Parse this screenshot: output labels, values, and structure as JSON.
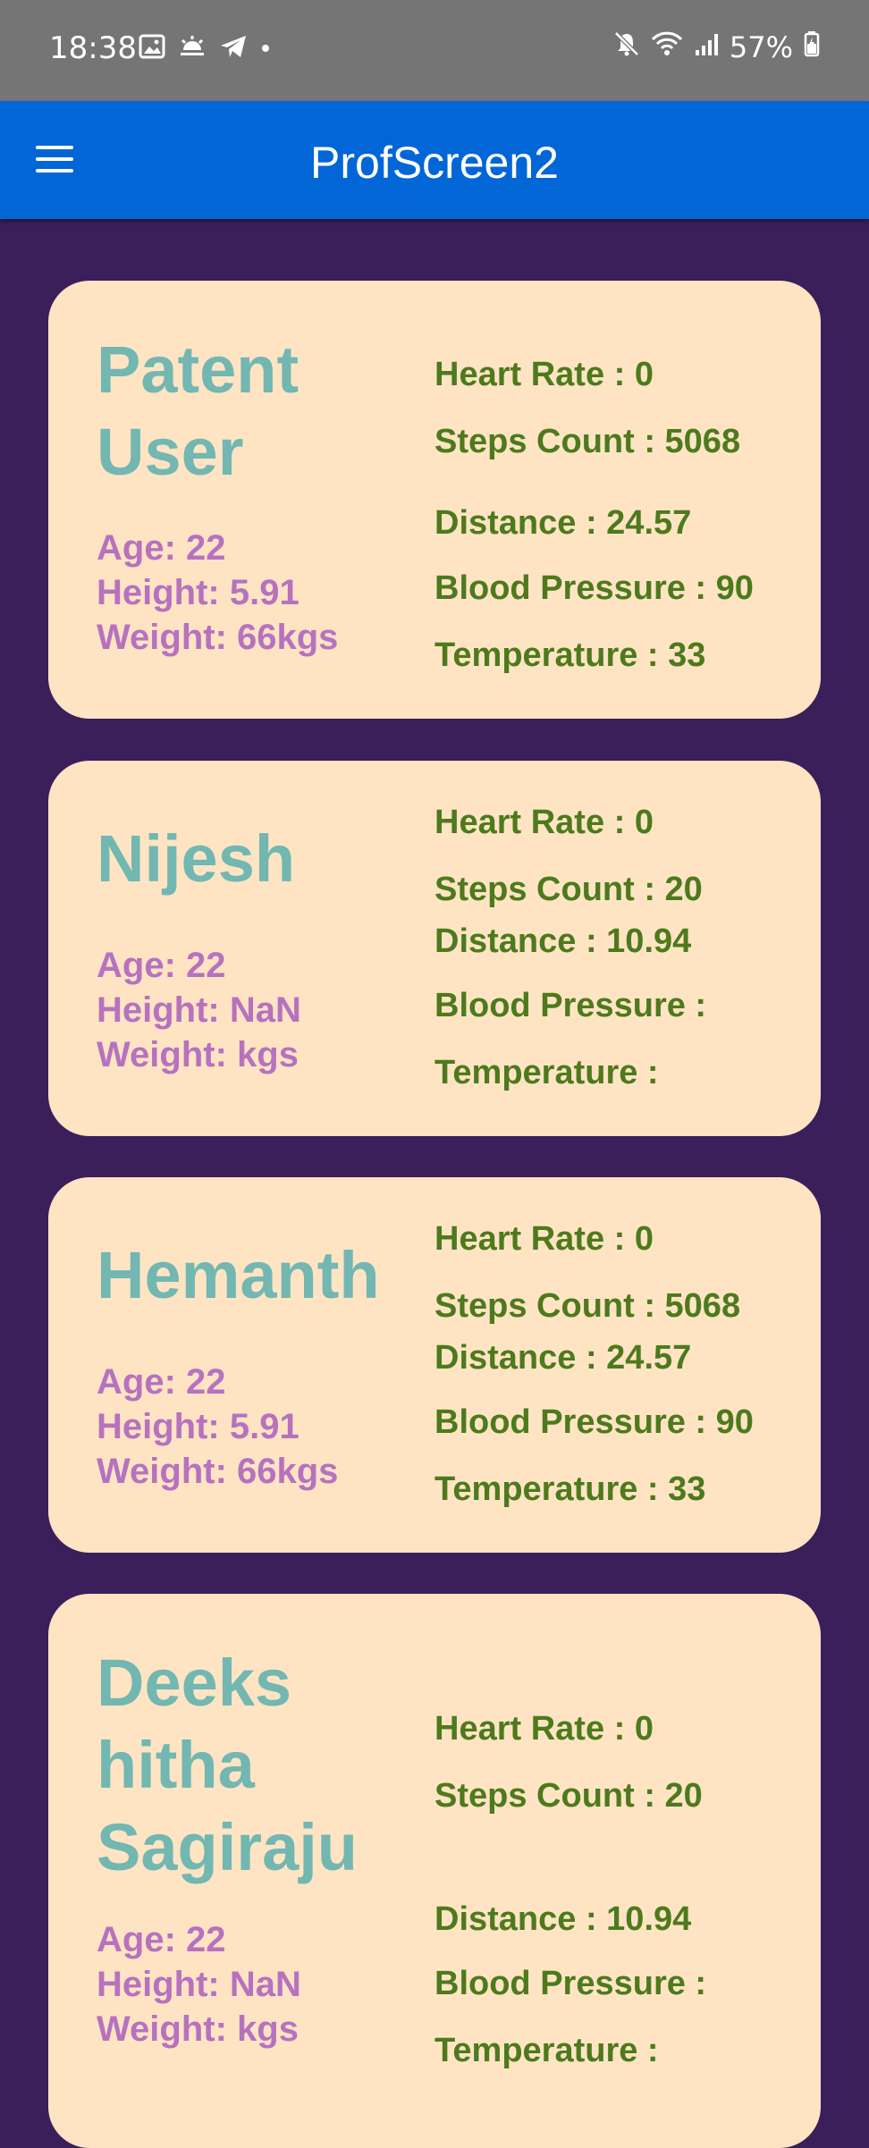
{
  "status_bar": {
    "time": "18:38",
    "battery": "57%",
    "left_icons": [
      "gallery-icon",
      "weather-icon",
      "telegram-icon",
      "dot-icon"
    ],
    "right_icons": [
      "mute-icon",
      "wifi-icon",
      "signal-icon",
      "battery-icon"
    ]
  },
  "app_bar": {
    "title": "ProfScreen2",
    "menu_icon": "hamburger-menu-icon"
  },
  "colors": {
    "background": "#3a1f5a",
    "app_bar": "#0366d6",
    "card": "#ffe4c4",
    "name": "#72b7b1",
    "info": "#b672bf",
    "stat": "#4d7a1c"
  },
  "profiles": [
    {
      "name": "Patent\nUser",
      "age": "Age: 22",
      "height": "Height: 5.91",
      "weight": "Weight: 66kgs",
      "heart_rate": "Heart Rate : 0",
      "steps": "Steps Count : 5068",
      "distance": "Distance : 24.57",
      "blood_pressure": "Blood Pressure : 90",
      "temperature": "Temperature : 33"
    },
    {
      "name": "Nijesh",
      "age": "Age: 22",
      "height": "Height: NaN",
      "weight": "Weight: kgs",
      "heart_rate": "Heart Rate : 0",
      "steps": "Steps Count : 20",
      "distance": "Distance : 10.94",
      "blood_pressure": "Blood Pressure :",
      "temperature": "Temperature :"
    },
    {
      "name": "Hemanth",
      "age": "Age: 22",
      "height": "Height: 5.91",
      "weight": "Weight: 66kgs",
      "heart_rate": "Heart Rate : 0",
      "steps": "Steps Count : 5068",
      "distance": "Distance : 24.57",
      "blood_pressure": "Blood Pressure : 90",
      "temperature": "Temperature : 33"
    },
    {
      "name": "Deeks\nhitha\nSagiraju",
      "age": "Age: 22",
      "height": "Height: NaN",
      "weight": "Weight: kgs",
      "heart_rate": "Heart Rate : 0",
      "steps": "Steps Count : 20",
      "distance": "Distance : 10.94",
      "blood_pressure": "Blood Pressure :",
      "temperature": "Temperature :"
    }
  ]
}
